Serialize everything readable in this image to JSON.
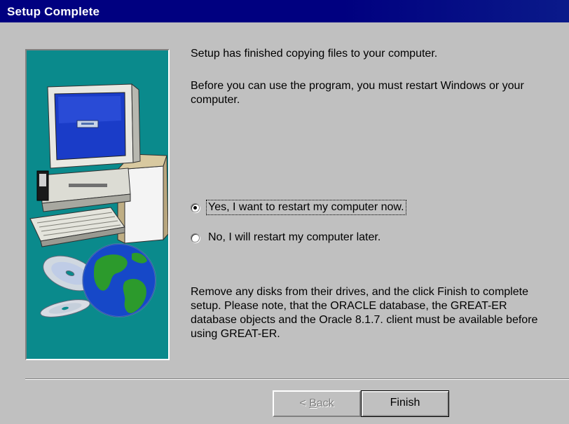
{
  "window": {
    "title": "Setup Complete"
  },
  "messages": {
    "copying": "Setup has finished copying files to your computer.",
    "restart": "Before you can use the program, you must restart Windows or your computer.",
    "remove": "Remove any disks from their drives, and the click Finish to complete setup. Please note, that the ORACLE database, the GREAT-ER database objects and the Oracle 8.1.7. client must be available before using GREAT-ER."
  },
  "options": [
    {
      "label": "Yes, I want to restart my computer now.",
      "selected": true
    },
    {
      "label": "No, I will restart my computer later.",
      "selected": false
    }
  ],
  "buttons": {
    "back_prefix": "< ",
    "back_mnemonic": "B",
    "back_rest": "ack",
    "back_enabled": false,
    "finish": "Finish"
  },
  "icons": {
    "illustration": "computer-box-cds-globe-illustration"
  },
  "colors": {
    "titlebar": "#000080",
    "panel": "#0a8a8c",
    "dialog": "#c0c0c0"
  }
}
